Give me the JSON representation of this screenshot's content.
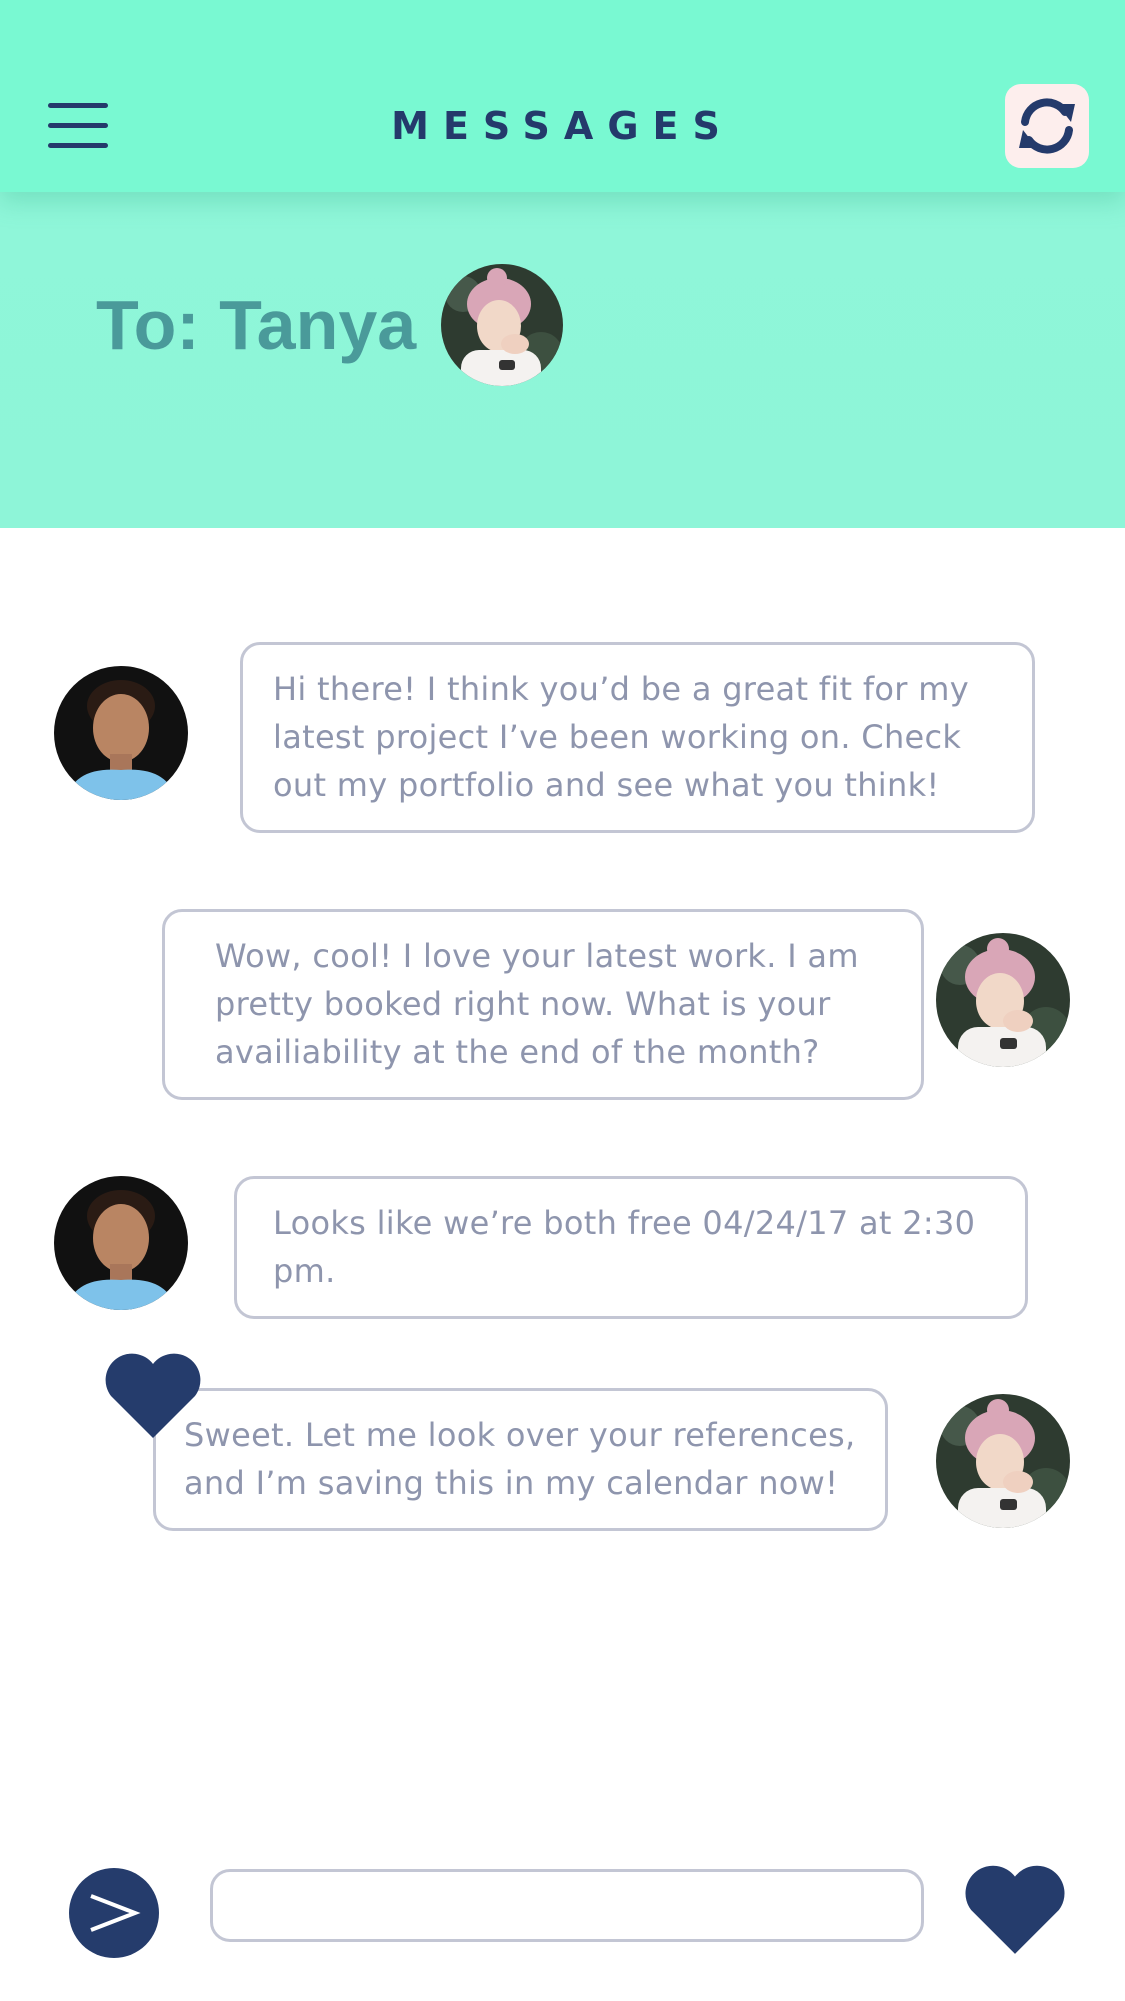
{
  "header": {
    "title": "MESSAGES",
    "menu_icon": "hamburger-menu-icon",
    "refresh_icon": "refresh-sync-icon",
    "background_color": "#79f9d2",
    "accent_color": "#243a6b"
  },
  "recipient": {
    "label": "To: Tanya",
    "avatar_icon": "tanya-avatar"
  },
  "messages": [
    {
      "sender": "other",
      "avatar_icon": "man-avatar",
      "lines": [
        "Hi there! I think you’d be a great fit for my",
        "latest project I’ve been working on. Check",
        "out my portfolio and see what you think!"
      ]
    },
    {
      "sender": "self",
      "avatar_icon": "tanya-avatar",
      "lines": [
        "Wow, cool! I love your latest work.  I am",
        "pretty booked right now. What is your",
        "availiability at the end of the month?"
      ]
    },
    {
      "sender": "other",
      "avatar_icon": "man-avatar",
      "lines": [
        "Looks like we’re both free 04/24/17 at 2:30",
        "pm."
      ]
    },
    {
      "sender": "self",
      "avatar_icon": "tanya-avatar",
      "liked": true,
      "lines": [
        "Sweet. Let me look over your references,",
        "and I’m saving this in my calendar now!"
      ]
    }
  ],
  "composer": {
    "input_value": "",
    "input_placeholder": "",
    "send_icon": "send-arrow-icon",
    "like_icon": "heart-icon"
  },
  "colors": {
    "bubble_border": "#c3c6d4",
    "bubble_text": "#8e95ad",
    "recipient_text": "#4a9a9a",
    "heart": "#253c6c"
  }
}
